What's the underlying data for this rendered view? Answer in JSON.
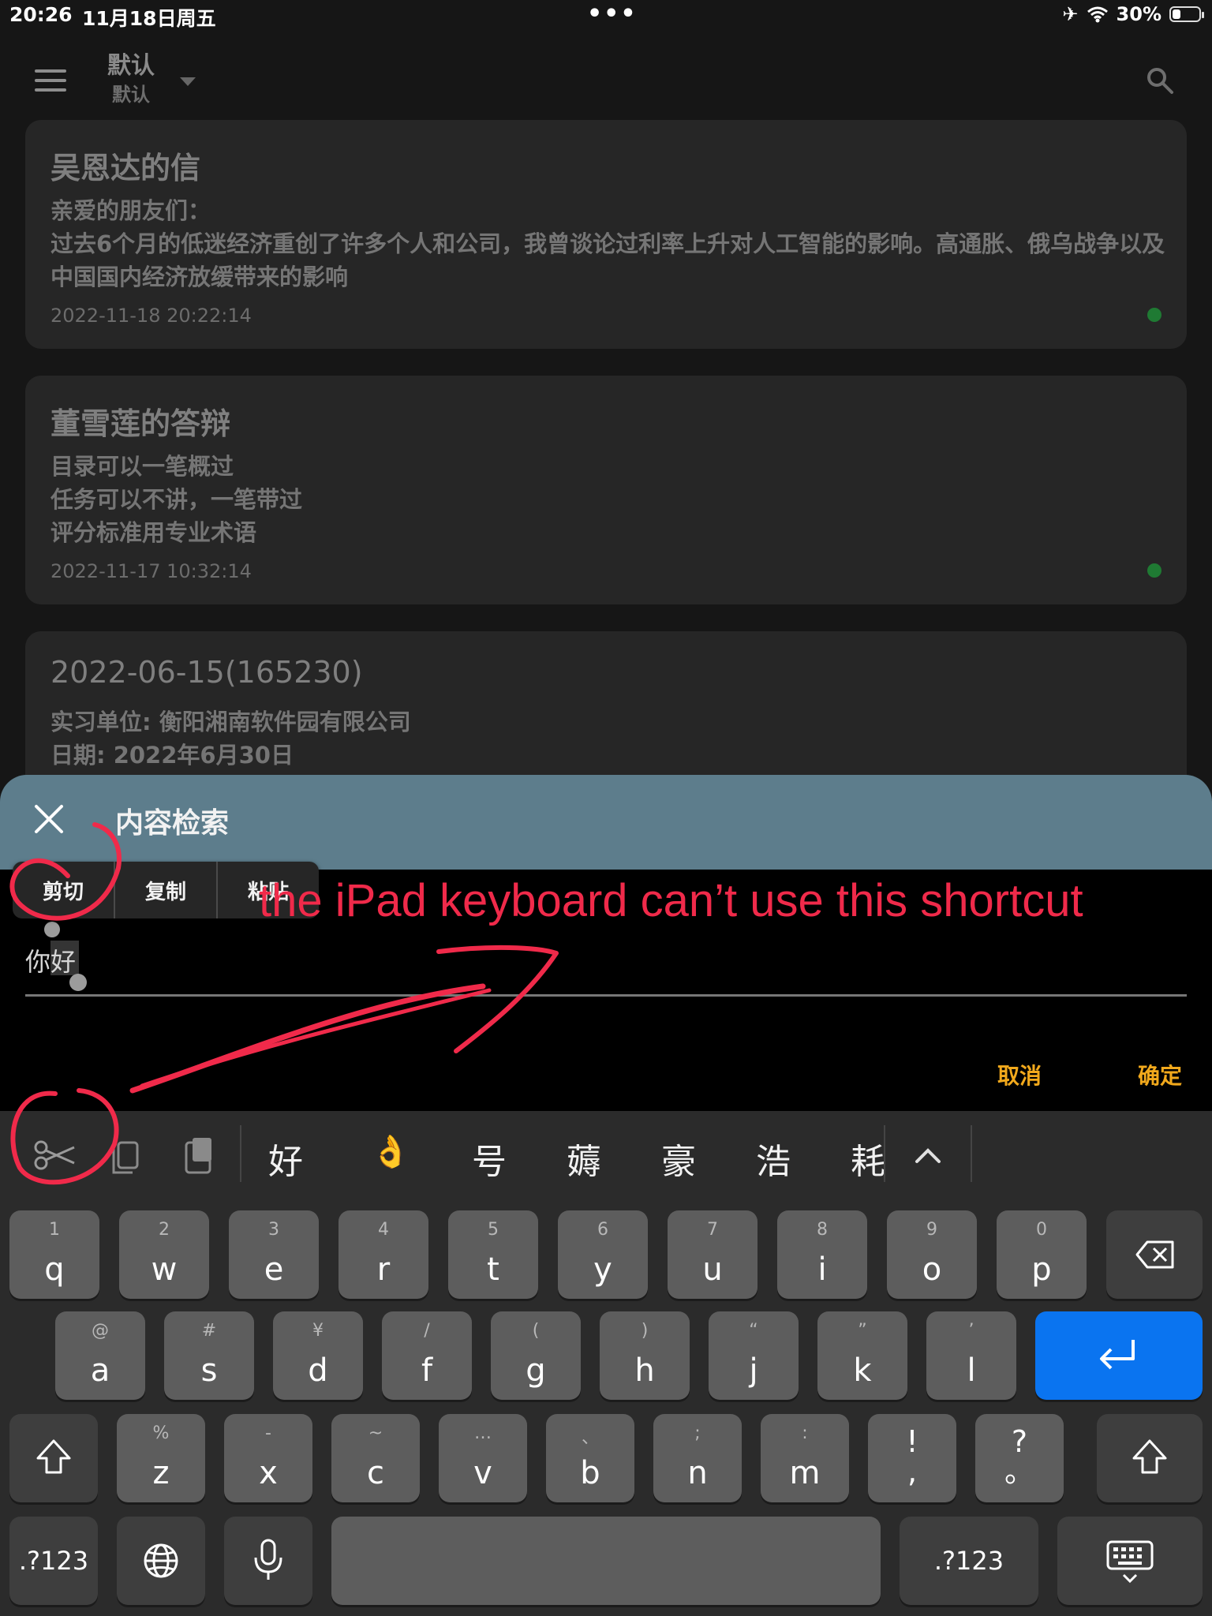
{
  "status_bar": {
    "time": "20:26",
    "date": "11月18日周五",
    "battery": "30%",
    "battery_level": 0.3
  },
  "header": {
    "title": "默认",
    "subtitle": "默认"
  },
  "notes": [
    {
      "title": "吴恩达的信",
      "body": "亲爱的朋友们：\n过去6个月的低迷经济重创了许多个人和公司，我曾谈论过利率上升对人工智能的影响。高通胀、俄乌战争以及中国国内经济放缓带来的影响",
      "timestamp": "2022-11-18 20:22:14"
    },
    {
      "title": "董雪莲的答辩",
      "body": "目录可以一笔概过\n任务可以不讲，一笔带过\n评分标准用专业术语",
      "timestamp": "2022-11-17 10:32:14"
    },
    {
      "title": "2022-06-15(165230)",
      "body": "实习单位: 衡阳湘南软件园有限公司\n日期: 2022年6月30日",
      "timestamp": ""
    }
  ],
  "dialog": {
    "title": "内容检索",
    "context_menu": [
      "剪切",
      "复制",
      "粘贴"
    ],
    "input_value": "你好",
    "cancel": "取消",
    "confirm": "确定"
  },
  "annotation": {
    "text": "the iPad keyboard can’t use this shortcut",
    "color": "#f02a4a"
  },
  "keyboard": {
    "candidates": [
      "好",
      "👌",
      "号",
      "薅",
      "豪",
      "浩",
      "耗"
    ],
    "row1": [
      {
        "hint": "1",
        "key": "q"
      },
      {
        "hint": "2",
        "key": "w"
      },
      {
        "hint": "3",
        "key": "e"
      },
      {
        "hint": "4",
        "key": "r"
      },
      {
        "hint": "5",
        "key": "t"
      },
      {
        "hint": "6",
        "key": "y"
      },
      {
        "hint": "7",
        "key": "u"
      },
      {
        "hint": "8",
        "key": "i"
      },
      {
        "hint": "9",
        "key": "o"
      },
      {
        "hint": "0",
        "key": "p"
      }
    ],
    "row2": [
      {
        "hint": "@",
        "key": "a"
      },
      {
        "hint": "#",
        "key": "s"
      },
      {
        "hint": "¥",
        "key": "d"
      },
      {
        "hint": "/",
        "key": "f"
      },
      {
        "hint": "(",
        "key": "g"
      },
      {
        "hint": ")",
        "key": "h"
      },
      {
        "hint": "“",
        "key": "j"
      },
      {
        "hint": "”",
        "key": "k"
      },
      {
        "hint": "’",
        "key": "l"
      }
    ],
    "row3": [
      {
        "hint": "%",
        "key": "z"
      },
      {
        "hint": "-",
        "key": "x"
      },
      {
        "hint": "~",
        "key": "c"
      },
      {
        "hint": "…",
        "key": "v"
      },
      {
        "hint": "、",
        "key": "b"
      },
      {
        "hint": ";",
        "key": "n"
      },
      {
        "hint": ":",
        "key": "m"
      }
    ],
    "row3_punct": [
      "!\n,",
      "?\n。"
    ],
    "numbers_key": ".?123",
    "numbers_key_right": ".?123"
  }
}
